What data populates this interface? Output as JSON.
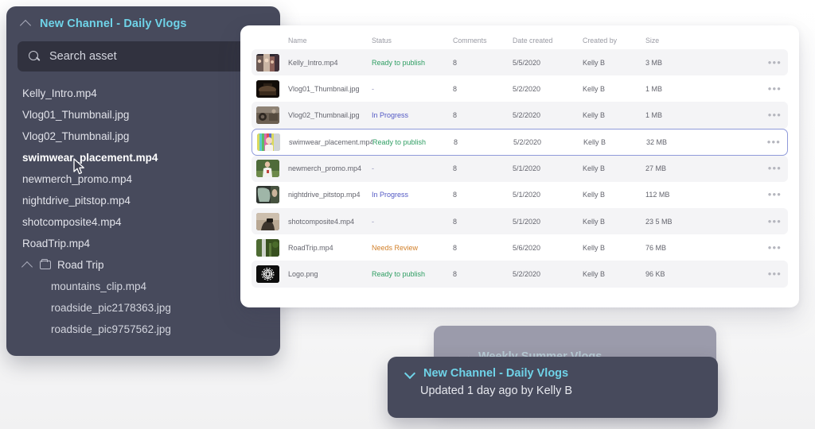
{
  "sidebar": {
    "title": "New Channel - Daily Vlogs",
    "collapse_icon": "chevron-up-icon",
    "search": {
      "placeholder": "Search asset",
      "value": "",
      "icon": "search-icon"
    },
    "items": [
      {
        "label": "Kelly_Intro.mp4",
        "active": false
      },
      {
        "label": "Vlog01_Thumbnail.jpg",
        "active": false
      },
      {
        "label": "Vlog02_Thumbnail.jpg",
        "active": false
      },
      {
        "label": "swimwear_placement.mp4",
        "active": true
      },
      {
        "label": "newmerch_promo.mp4",
        "active": false
      },
      {
        "label": "nightdrive_pitstop.mp4",
        "active": false
      },
      {
        "label": "shotcomposite4.mp4",
        "active": false
      },
      {
        "label": "RoadTrip.mp4",
        "active": false
      }
    ],
    "folder": {
      "label": "Road Trip",
      "icon": "folder-icon",
      "collapse_icon": "chevron-up-icon",
      "children": [
        "mountains_clip.mp4",
        "roadside_pic2178363.jpg",
        "roadside_pic9757562.jpg"
      ]
    }
  },
  "table": {
    "columns": [
      "Name",
      "Status",
      "Comments",
      "Date created",
      "Created by",
      "Size"
    ],
    "row_menu_icon": "ellipsis-icon",
    "rows": [
      {
        "thumb": "party-photo-thumbnail",
        "name": "Kelly_Intro.mp4",
        "status": "Ready to publish",
        "status_color": "#2f9e63",
        "comments": "8",
        "date": "5/5/2020",
        "by": "Kelly B",
        "size": "3 MB",
        "selected": false
      },
      {
        "thumb": "dark-room-thumbnail",
        "name": "Vlog01_Thumbnail.jpg",
        "status": "-",
        "status_color": "#8e8fb8",
        "comments": "8",
        "date": "5/2/2020",
        "by": "Kelly B",
        "size": "1 MB",
        "selected": false
      },
      {
        "thumb": "crowd-camera-thumbnail",
        "name": "Vlog02_Thumbnail.jpg",
        "status": "In Progress",
        "status_color": "#5258c4",
        "comments": "8",
        "date": "5/2/2020",
        "by": "Kelly B",
        "size": "1 MB",
        "selected": false
      },
      {
        "thumb": "colorbars-person-thumbnail",
        "name": "swimwear_placement.mp4",
        "status": "Ready to publish",
        "status_color": "#2f9e63",
        "comments": "8",
        "date": "5/2/2020",
        "by": "Kelly B",
        "size": "32 MB",
        "selected": true
      },
      {
        "thumb": "person-tshirt-thumbnail",
        "name": "newmerch_promo.mp4",
        "status": "-",
        "status_color": "#8e8fb8",
        "comments": "8",
        "date": "5/1/2020",
        "by": "Kelly B",
        "size": "27 MB",
        "selected": false
      },
      {
        "thumb": "car-window-thumbnail",
        "name": "nightdrive_pitstop.mp4",
        "status": "In Progress",
        "status_color": "#5258c4",
        "comments": "8",
        "date": "5/1/2020",
        "by": "Kelly B",
        "size": "112 MB",
        "selected": false
      },
      {
        "thumb": "photographer-thumbnail",
        "name": "shotcomposite4.mp4",
        "status": "-",
        "status_color": "#8e8fb8",
        "comments": "8",
        "date": "5/1/2020",
        "by": "Kelly B",
        "size": "23 5 MB",
        "selected": false
      },
      {
        "thumb": "roadside-trees-thumbnail",
        "name": "RoadTrip.mp4",
        "status": "Needs Review",
        "status_color": "#d2802a",
        "comments": "8",
        "date": "5/6/2020",
        "by": "Kelly B",
        "size": "76 MB",
        "selected": false
      },
      {
        "thumb": "logo-emblem-thumbnail",
        "name": "Logo.png",
        "status": "Ready to publish",
        "status_color": "#2f9e63",
        "comments": "8",
        "date": "5/2/2020",
        "by": "Kelly B",
        "size": "96 KB",
        "selected": false
      }
    ]
  },
  "cards": {
    "back": {
      "title": "Weekly Summer Vlogs",
      "chevron_icon": "chevron-down-icon"
    },
    "front": {
      "title": "New Channel - Daily Vlogs",
      "subtitle": "Updated 1 day ago by Kelly B",
      "chevron_icon": "chevron-down-icon"
    }
  },
  "colors": {
    "panel_dark": "#474a5c",
    "accent_cyan": "#6fd3e8",
    "status_ready": "#2f9e63",
    "status_progress": "#5258c4",
    "status_review": "#d2802a",
    "selected_border": "#8f9ada"
  }
}
